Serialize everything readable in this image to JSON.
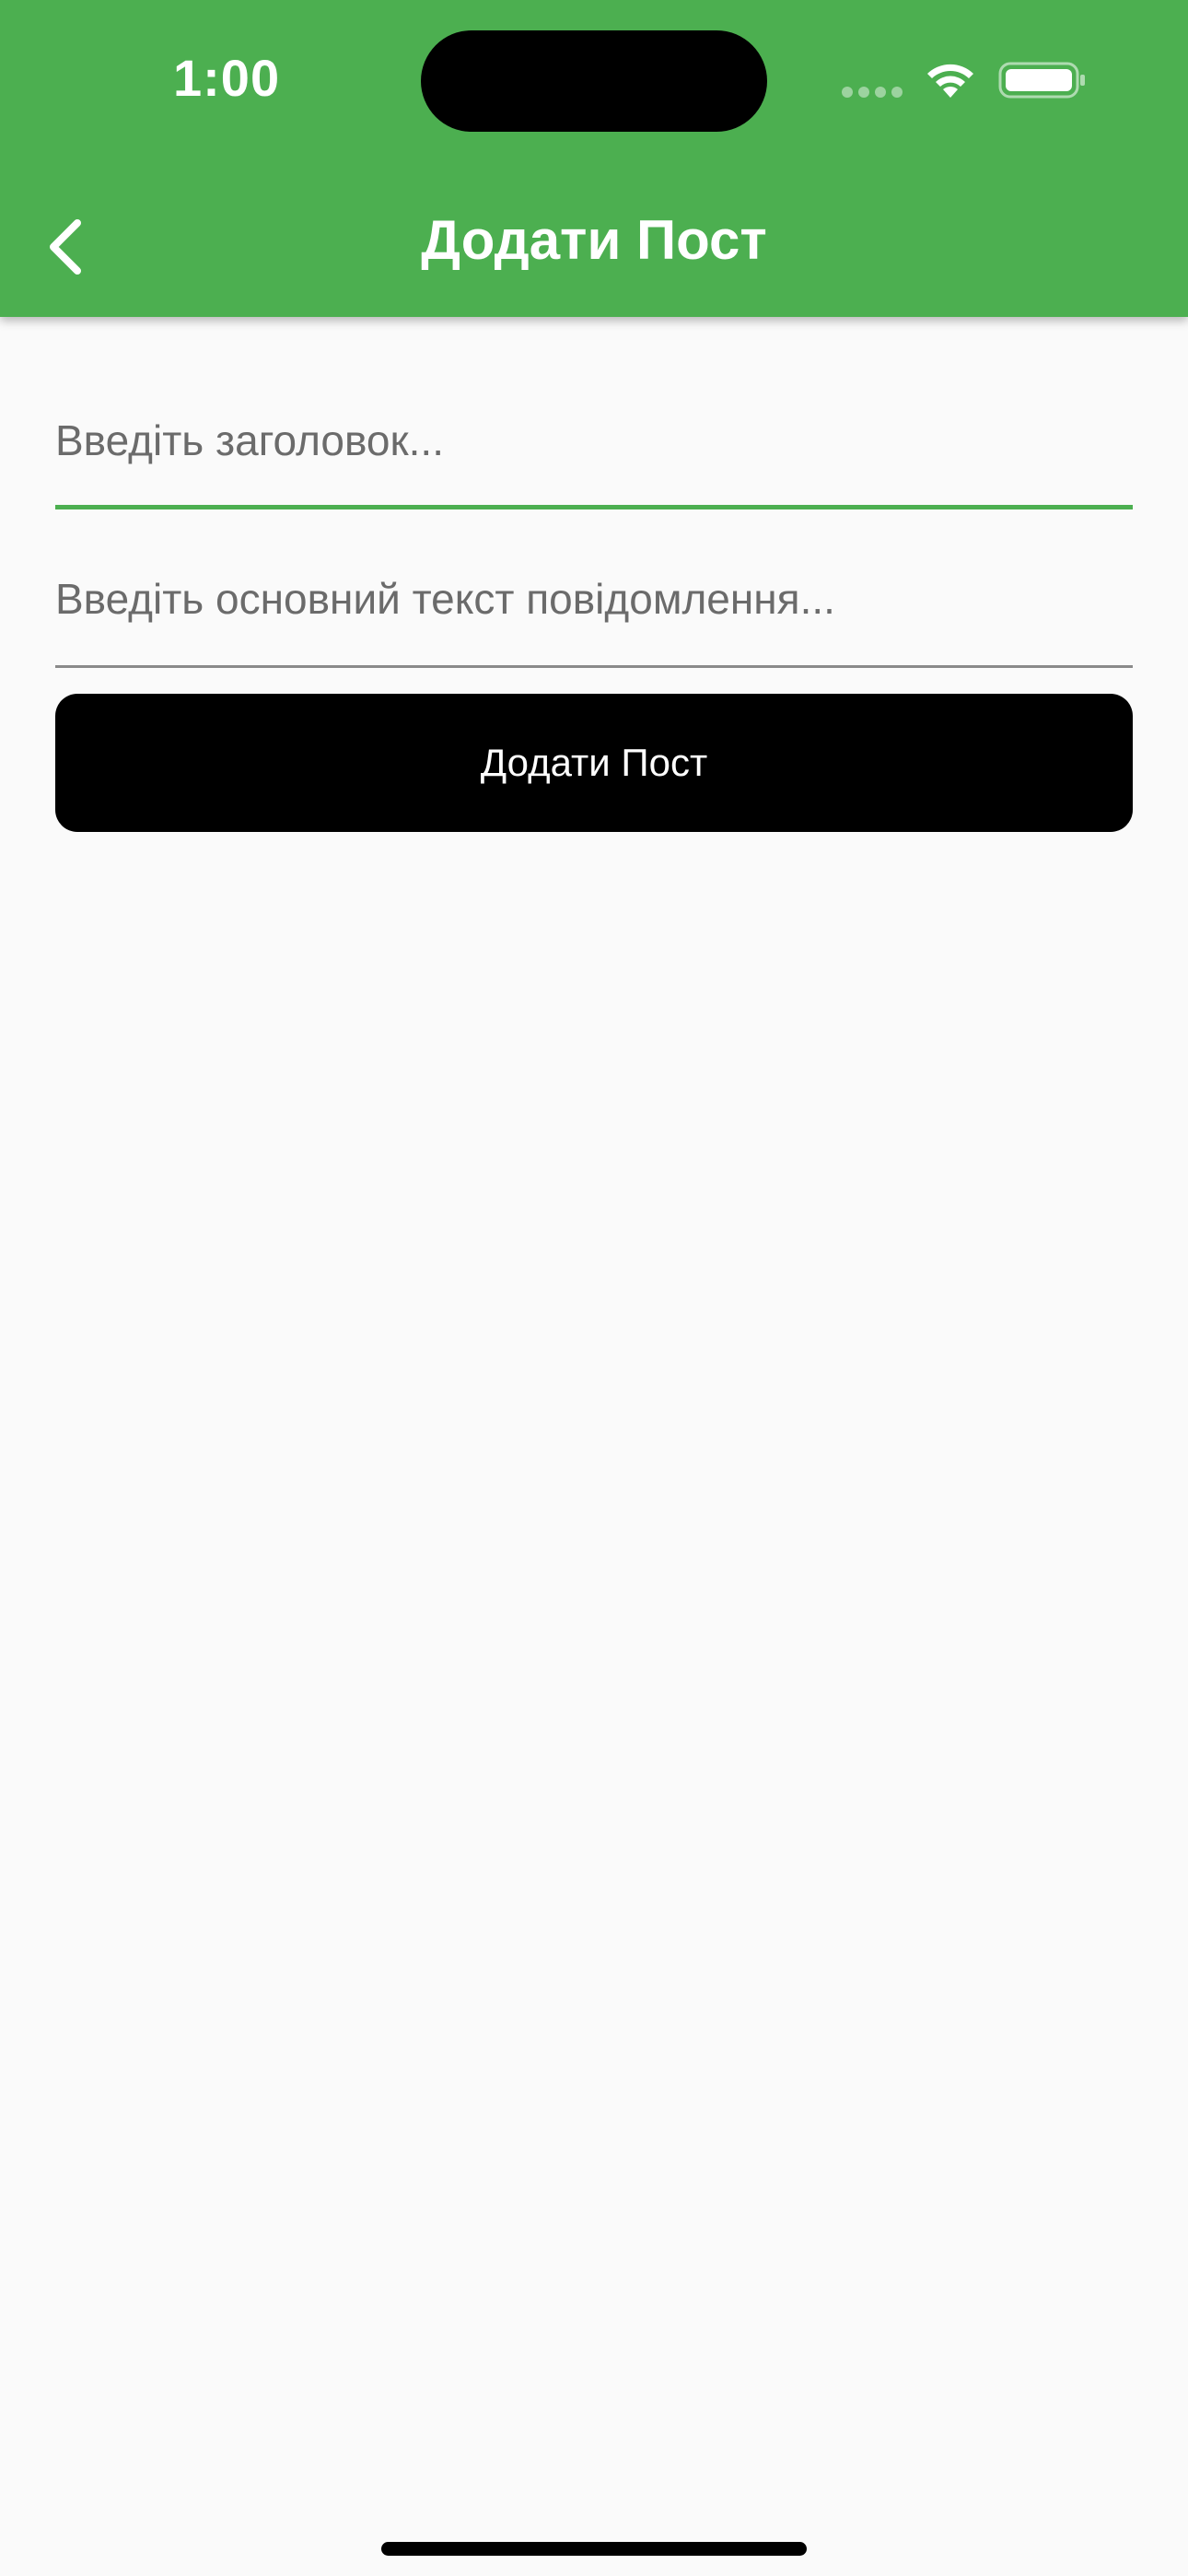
{
  "status_bar": {
    "time": "1:00",
    "icons": [
      "cellular-signal-icon",
      "wifi-icon",
      "battery-icon"
    ]
  },
  "app_bar": {
    "title": "Додати Пост",
    "back_icon": "chevron-left-icon",
    "background_color": "#4caf50"
  },
  "form": {
    "title_field": {
      "value": "",
      "placeholder": "Введіть заголовок..."
    },
    "body_field": {
      "value": "",
      "placeholder": "Введіть основний текст повідомлення..."
    },
    "submit_label": "Додати Пост"
  },
  "colors": {
    "accent": "#4caf50",
    "button": "#000000",
    "background": "#fafafa"
  }
}
